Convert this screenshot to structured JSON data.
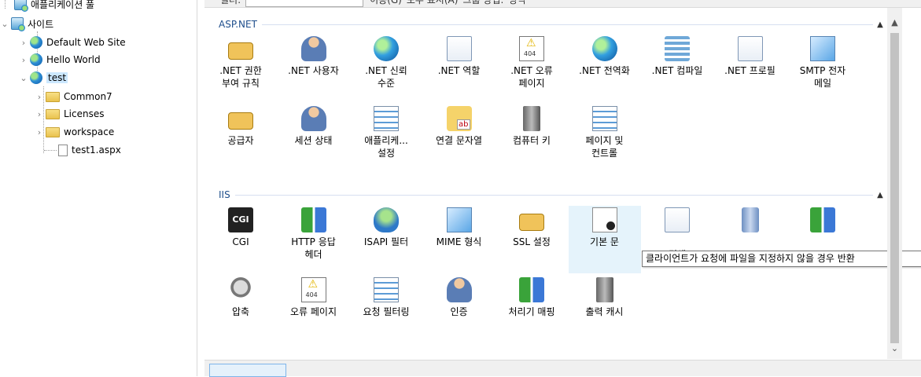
{
  "tree": {
    "app_pools": "애플리케이션 풀",
    "sites": "사이트",
    "items": [
      {
        "label": "Default Web Site",
        "icon": "globe-icon"
      },
      {
        "label": "Hello World",
        "icon": "globe-icon"
      },
      {
        "label": "test",
        "icon": "globe-icon",
        "selected": true
      }
    ],
    "test_children": [
      {
        "label": "Common7",
        "icon": "folder-icon"
      },
      {
        "label": "Licenses",
        "icon": "folder-icon"
      },
      {
        "label": "workspace",
        "icon": "folder-icon"
      },
      {
        "label": "test1.aspx",
        "icon": "file-icon"
      }
    ]
  },
  "filterbar": {
    "filter_label": "필터:",
    "go_label": "이동(G)",
    "show_all_label": "모두 표시(A)",
    "group_by_label": "그룹 방법:",
    "group_by_value": "영역"
  },
  "groups": {
    "aspnet": {
      "title": "ASP.NET",
      "items": [
        {
          "label": ".NET 권한\n부여 규칙",
          "icon": "authorization-lock-icon"
        },
        {
          "label": ".NET 사용자",
          "icon": "users-icon"
        },
        {
          "label": ".NET 신뢰\n수준",
          "icon": "trust-level-icon"
        },
        {
          "label": ".NET 역할",
          "icon": "roles-icon"
        },
        {
          "label": ".NET 오류\n페이지",
          "icon": "error-page-icon"
        },
        {
          "label": ".NET 전역화",
          "icon": "globalization-icon"
        },
        {
          "label": ".NET 컴파일",
          "icon": "compilation-icon"
        },
        {
          "label": ".NET 프로필",
          "icon": "profile-icon"
        },
        {
          "label": "SMTP 전자\n메일",
          "icon": "smtp-email-icon"
        },
        {
          "label": "공급자",
          "icon": "providers-icon"
        },
        {
          "label": "세션 상태",
          "icon": "session-state-icon"
        },
        {
          "label": "애플리케...\n설정",
          "icon": "app-settings-icon"
        },
        {
          "label": "연결 문자열",
          "icon": "connection-strings-icon"
        },
        {
          "label": "컴퓨터 키",
          "icon": "machine-key-icon"
        },
        {
          "label": "페이지 및\n컨트롤",
          "icon": "pages-controls-icon"
        }
      ]
    },
    "iis": {
      "title": "IIS",
      "items": [
        {
          "label": "CGI",
          "icon": "cgi-icon"
        },
        {
          "label": "HTTP 응답\n헤더",
          "icon": "http-headers-icon"
        },
        {
          "label": "ISAPI 필터",
          "icon": "isapi-filter-icon"
        },
        {
          "label": "MIME 형식",
          "icon": "mime-types-icon"
        },
        {
          "label": "SSL 설정",
          "icon": "ssl-lock-icon"
        },
        {
          "label": "기본 문",
          "icon": "default-document-icon",
          "hover": true
        },
        {
          "label": "\n검색",
          "icon": "directory-browsing-icon"
        },
        {
          "label": "",
          "icon": "logging-icon"
        },
        {
          "label": "",
          "icon": "modules-icon"
        },
        {
          "label": "압축",
          "icon": "compression-icon"
        },
        {
          "label": "오류 페이지",
          "icon": "error-pages-icon"
        },
        {
          "label": "요청 필터링",
          "icon": "request-filtering-icon"
        },
        {
          "label": "인증",
          "icon": "authentication-icon"
        },
        {
          "label": "처리기 매핑",
          "icon": "handler-mappings-icon"
        },
        {
          "label": "출력 캐시",
          "icon": "output-cache-icon"
        }
      ]
    }
  },
  "tooltip": "클라이언트가 요청에 파일을 지정하지 않을 경우 반환"
}
